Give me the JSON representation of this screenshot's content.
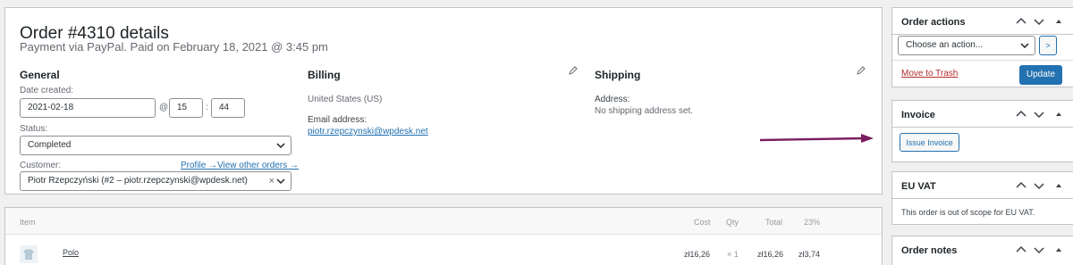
{
  "order": {
    "title": "Order #4310 details",
    "subtitle": "Payment via PayPal. Paid on February 18, 2021 @ 3:45 pm",
    "general": {
      "heading": "General",
      "date_label": "Date created:",
      "date_value": "2021-02-18",
      "at_sign": "@",
      "hour_value": "15",
      "colon": ":",
      "minute_value": "44",
      "status_label": "Status:",
      "status_value": "Completed",
      "customer_label": "Customer:",
      "profile_link": "Profile →",
      "other_orders_link": "View other orders →",
      "customer_value": "Piotr Rzepczyński (#2 – piotr.rzepczynski@wpdesk.net)",
      "clear_glyph": "×"
    },
    "billing": {
      "heading": "Billing",
      "country": "United States (US)",
      "email_label": "Email address:",
      "email_value": "piotr.rzepczynski@wpdesk.net"
    },
    "shipping": {
      "heading": "Shipping",
      "address_label": "Address:",
      "address_value": "No shipping address set."
    }
  },
  "items": {
    "headers": {
      "item": "Item",
      "cost": "Cost",
      "qty": "Qty",
      "total": "Total",
      "tax": "23%"
    },
    "rows": [
      {
        "name": "Polo",
        "cost": "zł16,26",
        "qty": "× 1",
        "total": "zł16,26",
        "tax": "zł3,74"
      }
    ]
  },
  "sidebar": {
    "actions": {
      "title": "Order actions",
      "select_placeholder": "Choose an action...",
      "go_label": ">",
      "trash_link": "Move to Trash",
      "update_button": "Update"
    },
    "invoice": {
      "title": "Invoice",
      "issue_button": "Issue Invoice"
    },
    "vat": {
      "title": "EU VAT",
      "message": "This order is out of scope for EU VAT."
    },
    "notes": {
      "title": "Order notes"
    }
  },
  "colors": {
    "accent": "#2271b1",
    "annotation_arrow": "#7a1d5e",
    "danger": "#b32d2e"
  },
  "icons": [
    "pencil-icon",
    "chevron-down-icon",
    "chevron-up-icon",
    "arrow-up-icon",
    "clear-icon",
    "shirt-icon",
    "annotation-arrow"
  ]
}
